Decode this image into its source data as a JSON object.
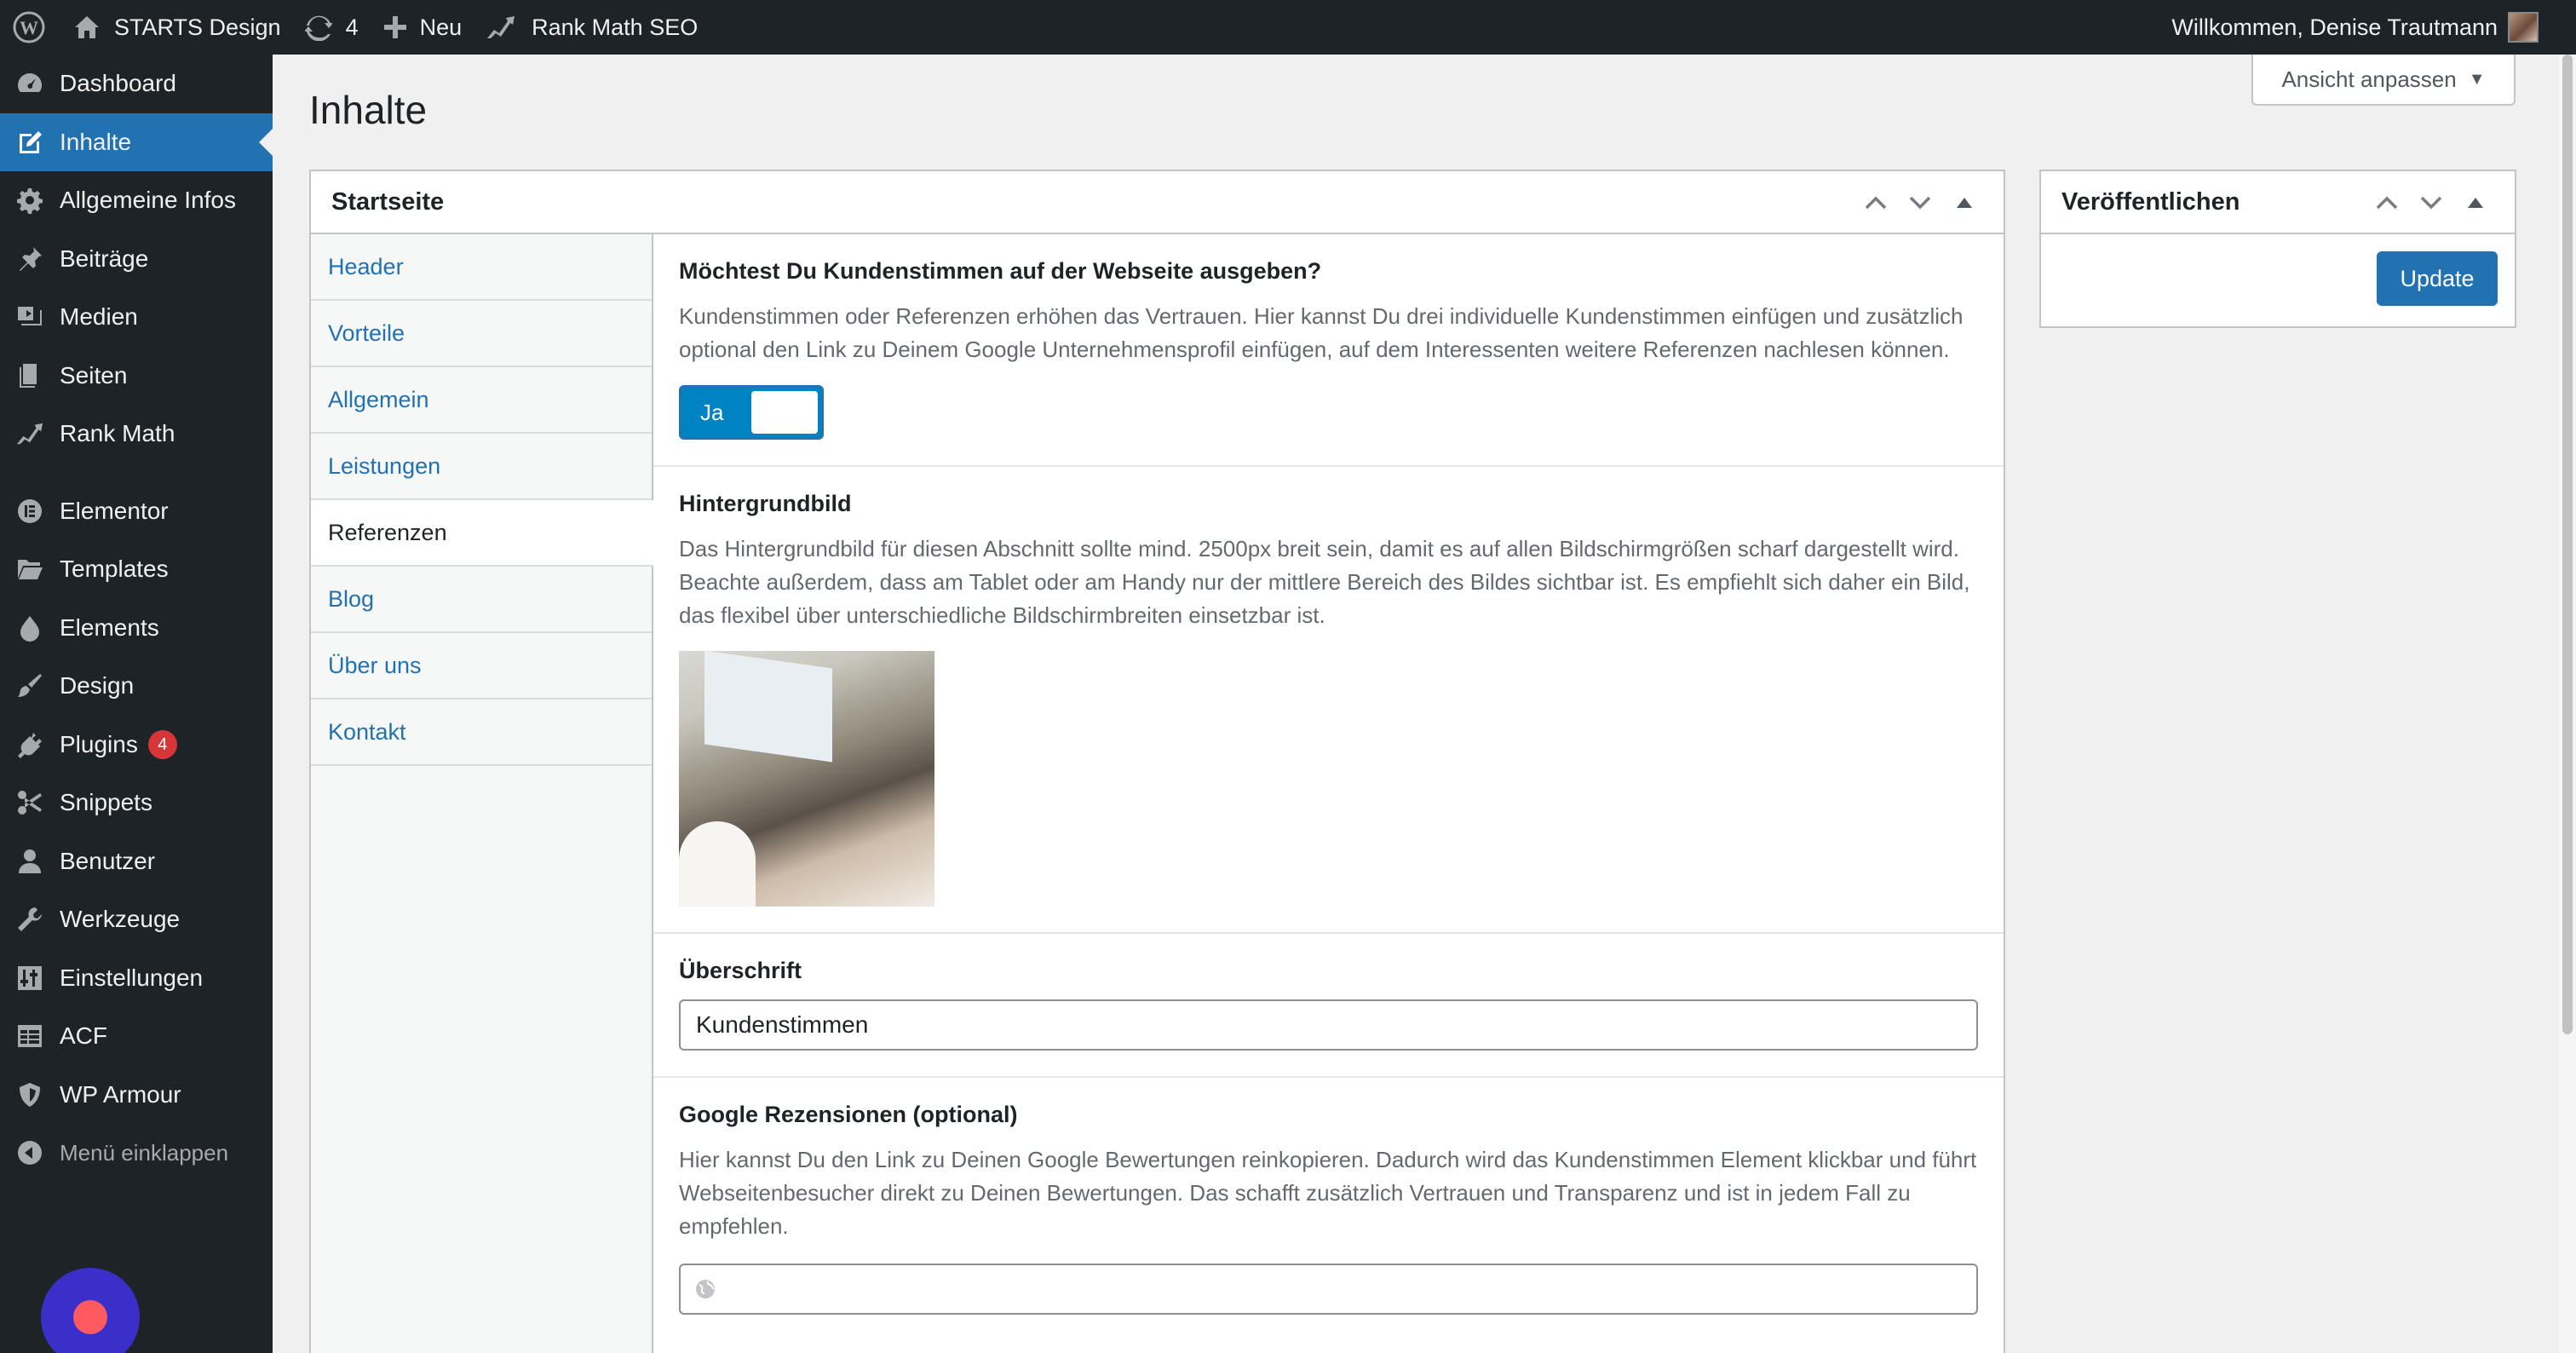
{
  "adminbar": {
    "site_name": "STARTS Design",
    "updates_count": "4",
    "new_label": "Neu",
    "rank_math_label": "Rank Math SEO",
    "welcome": "Willkommen, Denise Trautmann"
  },
  "sidebar": {
    "items": [
      {
        "label": "Dashboard",
        "icon": "dashboard-icon"
      },
      {
        "label": "Inhalte",
        "icon": "edit-icon"
      },
      {
        "label": "Allgemeine Infos",
        "icon": "gear-icon"
      },
      {
        "label": "Beiträge",
        "icon": "pin-icon"
      },
      {
        "label": "Medien",
        "icon": "media-icon"
      },
      {
        "label": "Seiten",
        "icon": "pages-icon"
      },
      {
        "label": "Rank Math",
        "icon": "rank-math-icon"
      },
      {
        "label": "Elementor",
        "icon": "elementor-icon"
      },
      {
        "label": "Templates",
        "icon": "folder-icon"
      },
      {
        "label": "Elements",
        "icon": "elements-icon"
      },
      {
        "label": "Design",
        "icon": "brush-icon"
      },
      {
        "label": "Plugins",
        "icon": "plug-icon",
        "badge": "4"
      },
      {
        "label": "Snippets",
        "icon": "scissors-icon"
      },
      {
        "label": "Benutzer",
        "icon": "user-icon"
      },
      {
        "label": "Werkzeuge",
        "icon": "wrench-icon"
      },
      {
        "label": "Einstellungen",
        "icon": "settings-icon"
      },
      {
        "label": "ACF",
        "icon": "table-icon"
      },
      {
        "label": "WP Armour",
        "icon": "shield-icon"
      }
    ],
    "collapse_label": "Menü einklappen"
  },
  "screen_options": {
    "label": "Ansicht anpassen"
  },
  "page": {
    "title": "Inhalte"
  },
  "startseite": {
    "title": "Startseite",
    "tabs": [
      "Header",
      "Vorteile",
      "Allgemein",
      "Leistungen",
      "Referenzen",
      "Blog",
      "Über uns",
      "Kontakt"
    ],
    "active_tab": "Referenzen",
    "fields": {
      "kundenstimmen": {
        "label": "Möchtest Du Kundenstimmen auf der Webseite ausgeben?",
        "desc": "Kundenstimmen oder Referenzen erhöhen das Vertrauen. Hier kannst Du drei individuelle Kundenstimmen einfügen und zusätzlich optional den Link zu Deinem Google Unternehmensprofil einfügen, auf dem Interessenten weitere Referenzen nachlesen können.",
        "toggle_label": "Ja"
      },
      "hintergrundbild": {
        "label": "Hintergrundbild",
        "desc": "Das Hintergrundbild für diesen Abschnitt sollte mind. 2500px breit sein, damit es auf allen Bildschirmgrößen scharf dargestellt wird. Beachte außerdem, dass am Tablet oder am Handy nur der mittlere Bereich des Bildes sichtbar ist. Es empfiehlt sich daher ein Bild, das flexibel über unterschiedliche Bildschirmbreiten einsetzbar ist."
      },
      "ueberschrift": {
        "label": "Überschrift",
        "value": "Kundenstimmen"
      },
      "google": {
        "label": "Google Rezensionen (optional)",
        "desc": "Hier kannst Du den Link zu Deinen Google Bewertungen reinkopieren. Dadurch wird das Kundenstimmen Element klickbar und führt Webseitenbesucher direkt zu Deinen Bewertungen. Das schafft zusätzlich Vertrauen und Transparenz und ist in jedem Fall zu empfehlen."
      }
    }
  },
  "publish": {
    "title": "Veröffentlichen",
    "update_label": "Update"
  },
  "colors": {
    "admin_bg": "#1d2327",
    "accent": "#2271b1",
    "toggle_on": "#0083c3",
    "badge": "#d63638"
  }
}
